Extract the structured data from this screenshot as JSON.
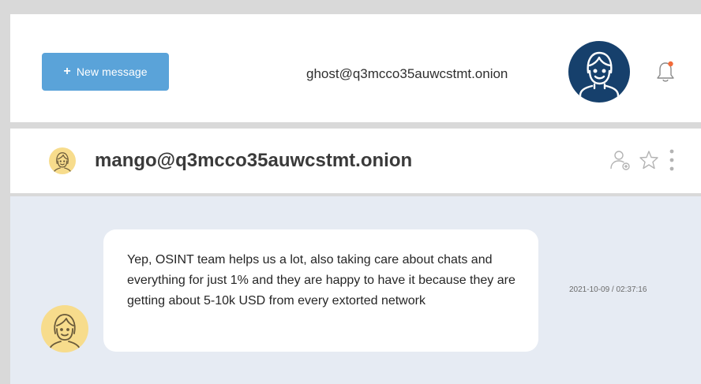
{
  "header": {
    "new_message_label": "New message",
    "new_message_icon": "plus",
    "current_user": "ghost@q3mcco35auwcstmt.onion",
    "notification_icon": "bell-icon",
    "notification_dot_color": "#f26b3a"
  },
  "conversation": {
    "contact": "mango@q3mcco35auwcstmt.onion",
    "actions": [
      "add-contact-icon",
      "star-icon",
      "more-vertical-icon"
    ]
  },
  "messages": [
    {
      "text": "Yep, OSINT team helps us a lot, also taking care about chats and everything for just 1% and they are happy to have it because they are getting about 5-10k USD from every extorted network",
      "timestamp": "2021-10-09 / 02:37:16"
    }
  ],
  "colors": {
    "accent": "#5aa3d9",
    "avatar_dark": "#16406c",
    "avatar_light": "#f7dc8c",
    "chat_background": "#e6ebf3"
  }
}
